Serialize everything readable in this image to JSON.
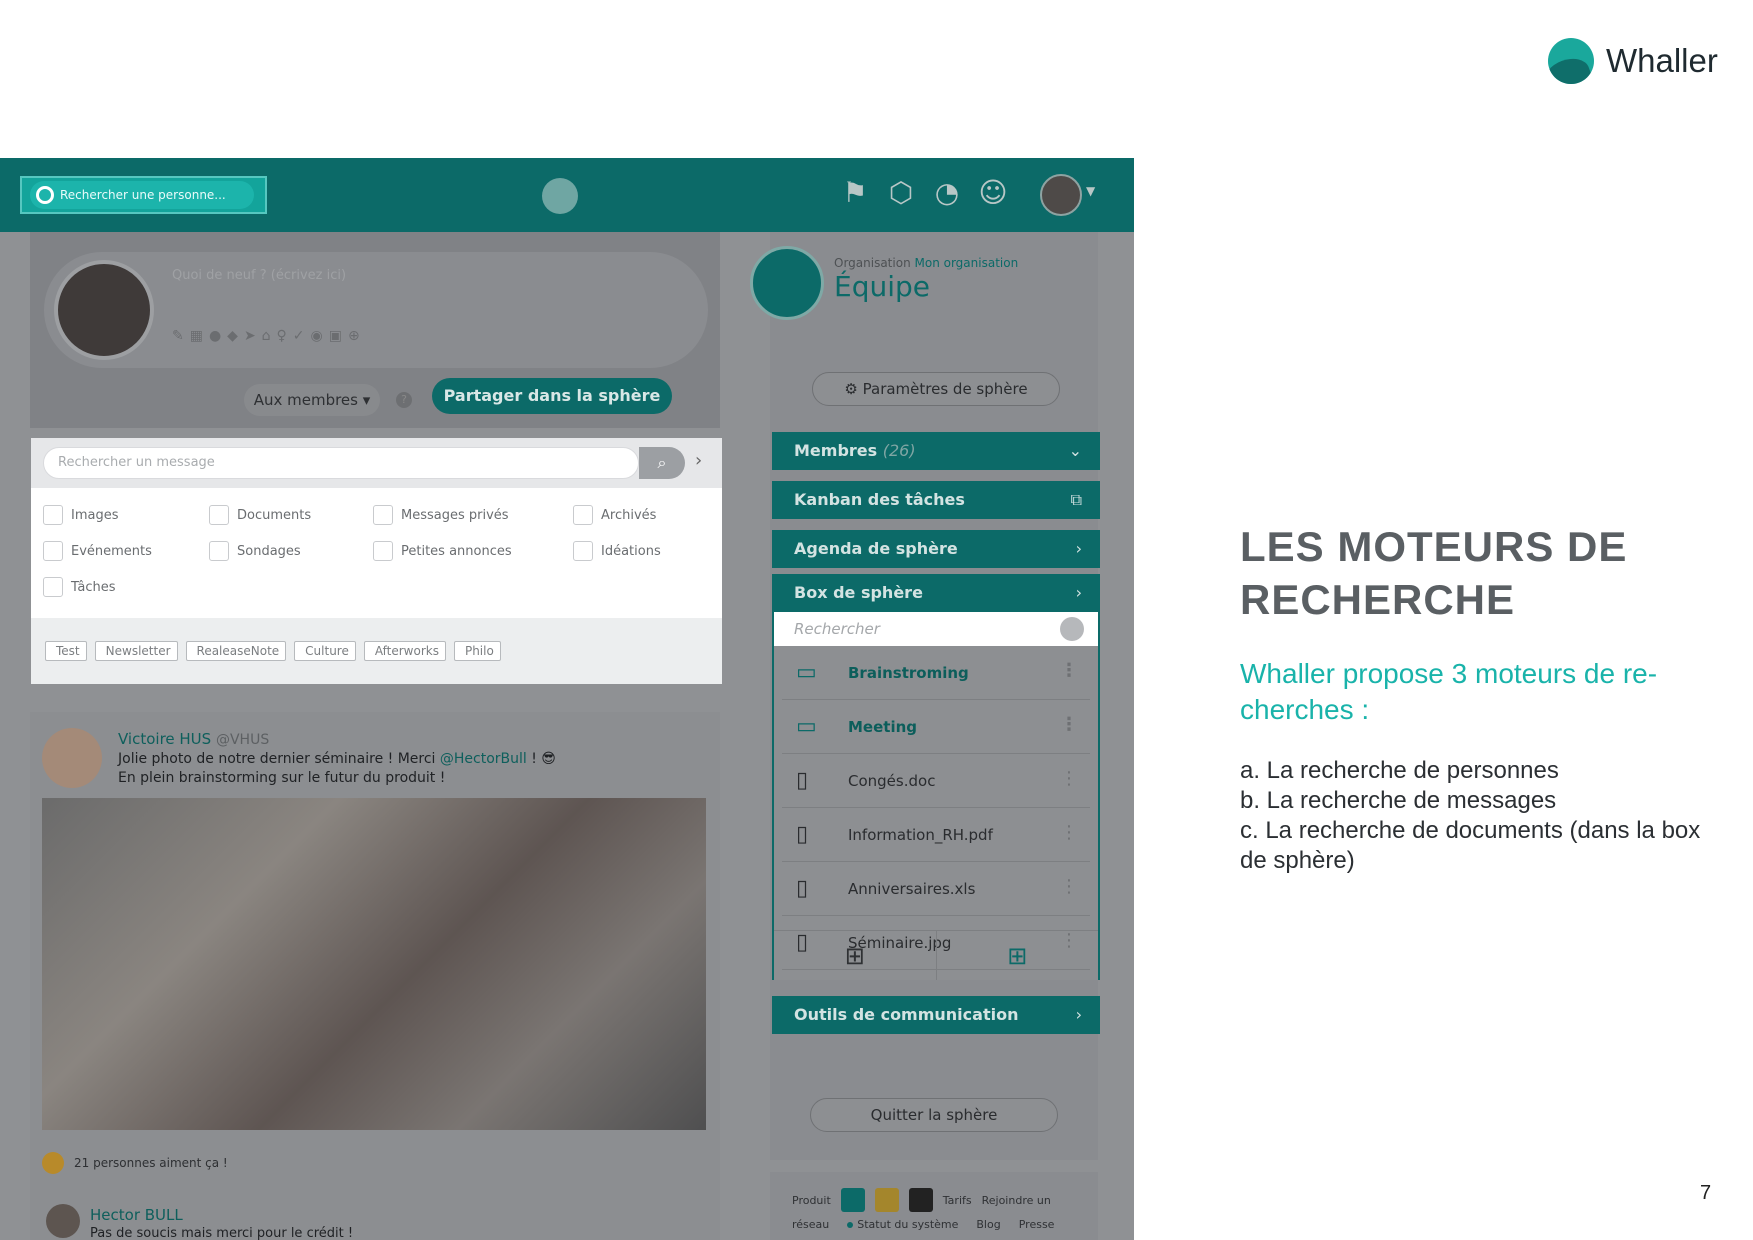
{
  "brand": {
    "name": "Whaller"
  },
  "slide": {
    "title": "LES MOTEURS DE RECHERCHE",
    "subtitle": "Whaller propose 3 moteurs de re-cherches :",
    "list": [
      "a. La recherche de personnes",
      "b. La recherche de messages",
      "c. La recherche de documents (dans la box de sphère)"
    ],
    "page_number": "7"
  },
  "topbar": {
    "person_search_placeholder": "Rechercher une personne..."
  },
  "composer": {
    "placeholder": "Quoi de neuf ? (écrivez ici)",
    "audience": "Aux membres ▾",
    "share_label": "Partager dans la sphère"
  },
  "message_search": {
    "placeholder": "Rechercher un message",
    "filters": [
      "Images",
      "Documents",
      "Messages privés",
      "Archivés",
      "Evénements",
      "Sondages",
      "Petites annonces",
      "Idéations",
      "Tâches"
    ],
    "tags": [
      "Test",
      "Newsletter",
      "RealeaseNote",
      "Culture",
      "Afterworks",
      "Philo"
    ]
  },
  "post": {
    "author": "Victoire HUS",
    "handle": "@VHUS",
    "text_before": "Jolie photo de notre dernier séminaire ! Merci ",
    "mention": "@HectorBull",
    "text_after": " ! 😎",
    "text_line2": "En plein brainstorming sur le futur du produit !",
    "likes": "21 personnes aiment ça !",
    "reply_author": "Hector BULL",
    "reply_text": "Pas de soucis mais merci pour le crédit !"
  },
  "sphere": {
    "org_label": "Organisation",
    "org_name": "Mon organisation",
    "name": "Équipe",
    "params_label": "Paramètres de sphère",
    "members_label": "Membres",
    "members_count": "(26)",
    "kanban_label": "Kanban des tâches",
    "agenda_label": "Agenda de sphère",
    "box_label": "Box de sphère",
    "doc_search_placeholder": "Rechercher",
    "files": [
      {
        "name": "Brainstroming",
        "kind": "folder"
      },
      {
        "name": "Meeting",
        "kind": "folder"
      },
      {
        "name": "Congés.doc",
        "kind": "file"
      },
      {
        "name": "Information_RH.pdf",
        "kind": "file"
      },
      {
        "name": "Anniversaires.xls",
        "kind": "file"
      },
      {
        "name": "Séminaire.jpg",
        "kind": "file"
      }
    ],
    "comm_label": "Outils de communication",
    "leave_label": "Quitter la sphère"
  },
  "footer": {
    "row1": [
      "Produit",
      "Tarifs",
      "Rejoindre un"
    ],
    "row2": [
      "réseau",
      "Statut du système",
      "Blog",
      "Presse"
    ]
  }
}
